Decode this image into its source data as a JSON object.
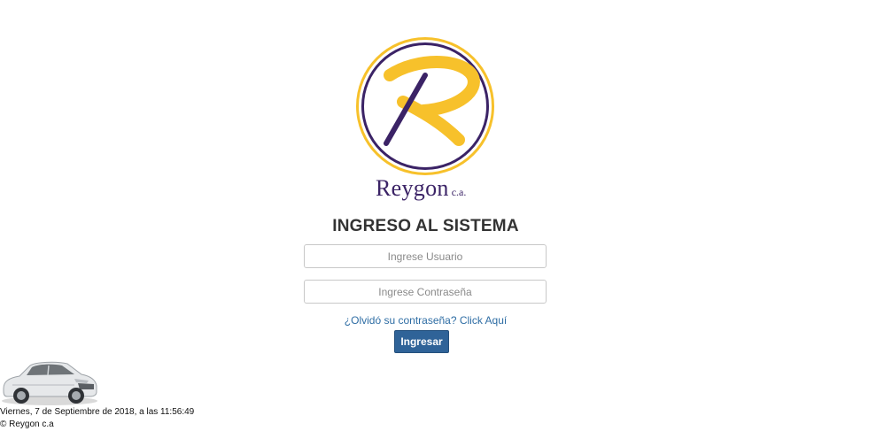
{
  "brand": {
    "name": "Reygon",
    "suffix": "c.a.",
    "colors": {
      "purple": "#3b2366",
      "gold": "#f7c12b"
    }
  },
  "login": {
    "title": "INGRESO AL SISTEMA",
    "username_placeholder": "Ingrese Usuario",
    "username_value": "",
    "password_placeholder": "Ingrese Contraseña",
    "password_value": "",
    "forgot_link": "¿Olvidó su contraseña? Click Aquí",
    "submit_label": "Ingresar",
    "button_color": "#2f6398"
  },
  "footer": {
    "datetime": "Viernes, 7 de Septiembre de 2018, a las 11:56:49",
    "copyright": "© Reygon c.a"
  },
  "icons": {
    "logo": "reygon-logo-icon",
    "car": "car-image"
  }
}
